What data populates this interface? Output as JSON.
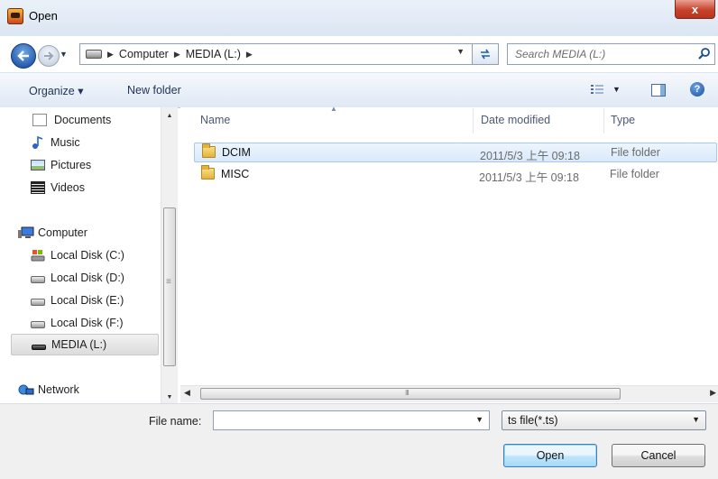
{
  "window": {
    "title": "Open",
    "close_label": "x"
  },
  "address": {
    "crumbs": [
      "Computer",
      "MEDIA (L:)"
    ],
    "search_placeholder": "Search MEDIA (L:)"
  },
  "toolbar": {
    "organize_label": "Organize ▾",
    "new_folder_label": "New folder"
  },
  "nav": {
    "favorites": [
      "Documents",
      "Music",
      "Pictures",
      "Videos"
    ],
    "computer_label": "Computer",
    "drives": [
      "Local Disk (C:)",
      "Local Disk (D:)",
      "Local Disk (E:)",
      "Local Disk (F:)",
      "MEDIA (L:)"
    ],
    "network_label": "Network",
    "selected": "MEDIA (L:)"
  },
  "columns": {
    "name": "Name",
    "date": "Date modified",
    "type": "Type"
  },
  "files": [
    {
      "name": "DCIM",
      "date": "2011/5/3 上午 09:18",
      "type": "File folder",
      "selected": true
    },
    {
      "name": "MISC",
      "date": "2011/5/3 上午 09:18",
      "type": "File folder",
      "selected": false
    }
  ],
  "bottom": {
    "file_name_label": "File name:",
    "file_name_value": "",
    "filter_value": "ts file(*.ts)",
    "open_label": "Open",
    "cancel_label": "Cancel"
  },
  "colors": {
    "accent": "#3c7fb1",
    "close_red": "#c7422b",
    "selection": "#d9e9fb"
  }
}
